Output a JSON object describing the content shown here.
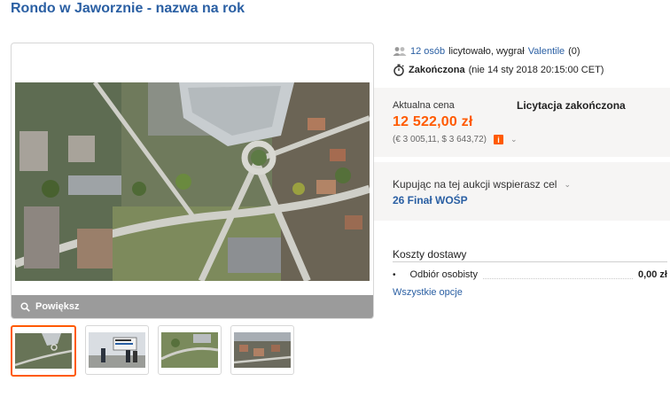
{
  "page": {
    "title": "Rondo w Jaworznie - nazwa na rok"
  },
  "gallery": {
    "zoom_label": "Powiększ",
    "thumbnails": [
      {
        "id": "aerial-roundabout"
      },
      {
        "id": "sign-ceremony"
      },
      {
        "id": "aerial-road"
      },
      {
        "id": "aerial-town"
      }
    ]
  },
  "auction": {
    "bidders_count": "12 osób",
    "bid_text": "licytowało, wygrał",
    "winner": "Valentile",
    "winner_score": "(0)",
    "status": "Zakończona",
    "end_date": "(nie 14 sty 2018 20:15:00 CET)"
  },
  "price": {
    "label": "Aktualna cena",
    "value": "12 522,00 zł",
    "conversion": "(€ 3 005,11, $ 3 643,72)",
    "status": "Licytacja zakończona",
    "info_icon": "i"
  },
  "cause": {
    "text": "Kupując na tej aukcji wspierasz cel",
    "name": "26 Finał WOŚP"
  },
  "shipping": {
    "title": "Koszty dostawy",
    "method": "Odbiór osobisty",
    "cost": "0,00 zł",
    "all_options": "Wszystkie opcje"
  },
  "colors": {
    "accent": "#ff5a00",
    "link": "#2a5fa3",
    "panel": "#f6f5f4"
  },
  "icons": [
    "people-icon",
    "stopwatch-icon",
    "info-icon",
    "chevron-down-icon",
    "magnifier-icon"
  ]
}
